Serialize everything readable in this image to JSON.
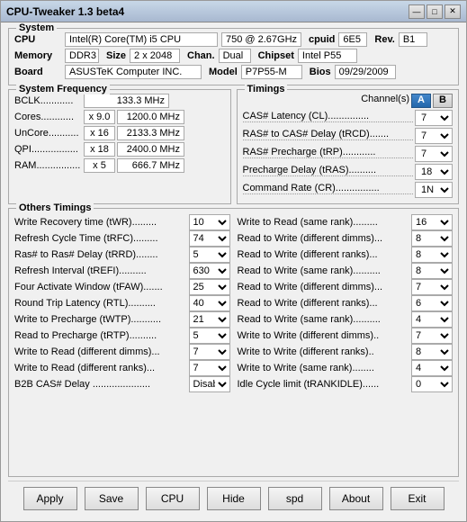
{
  "window": {
    "title": "CPU-Tweaker 1.3 beta4",
    "min_btn": "—",
    "max_btn": "□",
    "close_btn": "✕"
  },
  "system": {
    "group_label": "System",
    "cpu_label": "CPU",
    "cpu_value": "Intel(R) Core(TM) i5 CPU",
    "cpu_speed": "750 @ 2.67GHz",
    "cpuid_label": "cpuid",
    "cpuid_value": "6E5",
    "rev_label": "Rev.",
    "rev_value": "B1",
    "memory_label": "Memory",
    "mem_type": "DDR3",
    "size_label": "Size",
    "size_value": "2 x 2048",
    "chan_label": "Chan.",
    "chan_value": "Dual",
    "chipset_label": "Chipset",
    "chipset_value": "Intel P55",
    "board_label": "Board",
    "board_value": "ASUSTeK Computer INC.",
    "model_label": "Model",
    "model_value": "P7P55-M",
    "bios_label": "Bios",
    "bios_value": "09/29/2009"
  },
  "freq": {
    "group_label": "System Frequency",
    "bclk_label": "BCLK............",
    "bclk_value": "133.3 MHz",
    "cores_label": "Cores............",
    "cores_multi": "x 9.0",
    "cores_value": "1200.0 MHz",
    "uncore_label": "UnCore...........",
    "uncore_multi": "x 16",
    "uncore_value": "2133.3 MHz",
    "qpi_label": "QPI.................",
    "qpi_multi": "x 18",
    "qpi_value": "2400.0 MHz",
    "ram_label": "RAM................",
    "ram_multi": "x 5",
    "ram_value": "666.7 MHz"
  },
  "timings": {
    "group_label": "Timings",
    "channel_label": "Channel(s)",
    "chan_a": "A",
    "chan_b": "B",
    "cas_label": "CAS# Latency (CL)...............",
    "cas_value": "7",
    "rcd_label": "RAS# to CAS# Delay (tRCD).......",
    "rcd_value": "7",
    "rp_label": "RAS# Precharge (tRP)............",
    "rp_value": "7",
    "ras_label": "Precharge Delay (tRAS)..........",
    "ras_value": "18",
    "cr_label": "Command Rate (CR)................",
    "cr_value": "1N"
  },
  "others": {
    "group_label": "Others Timings",
    "rows_left": [
      {
        "label": "Write Recovery time (tWR).........",
        "value": "10"
      },
      {
        "label": "Refresh Cycle Time (tRFC).........",
        "value": "74"
      },
      {
        "label": "Ras# to Ras# Delay (tRRD)........",
        "value": "5"
      },
      {
        "label": "Refresh Interval (tREFI)..........",
        "value": "630"
      },
      {
        "label": "Four Activate Window (tFAW).......",
        "value": "25"
      },
      {
        "label": "Round Trip Latency (RTL)..........",
        "value": "40"
      },
      {
        "label": "Write to Precharge (tWTP).........",
        "value": "21"
      },
      {
        "label": "Read to Precharge (tRTP)..........",
        "value": "5"
      },
      {
        "label": "Write to Read (different dimms)...",
        "value": "7"
      },
      {
        "label": "Write to Read (different ranks)...",
        "value": "7"
      },
      {
        "label": "B2B CAS# Delay ...................",
        "value": "Disab."
      }
    ],
    "rows_right": [
      {
        "label": "Write to Read (same rank).........",
        "value": "16"
      },
      {
        "label": "Read to Write (different dimms)...",
        "value": "8"
      },
      {
        "label": "Read to Write (different ranks)...",
        "value": "8"
      },
      {
        "label": "Read to Write (same rank).........",
        "value": "8"
      },
      {
        "label": "Read to Write (different dimms)...",
        "value": "7"
      },
      {
        "label": "Read to Write (different ranks)...",
        "value": "6"
      },
      {
        "label": "Read to Write (same rank).........",
        "value": "4"
      },
      {
        "label": "Write to Write (different dimms)..",
        "value": "7"
      },
      {
        "label": "Write to Write (different ranks)..",
        "value": "8"
      },
      {
        "label": "Write to Write (same rank)........",
        "value": "4"
      },
      {
        "label": "Idle Cycle limit (tRANKIDLE)......",
        "value": "0"
      }
    ]
  },
  "buttons": {
    "apply": "Apply",
    "save": "Save",
    "cpu": "CPU",
    "hide": "Hide",
    "spd": "spd",
    "about": "About",
    "exit": "Exit"
  }
}
